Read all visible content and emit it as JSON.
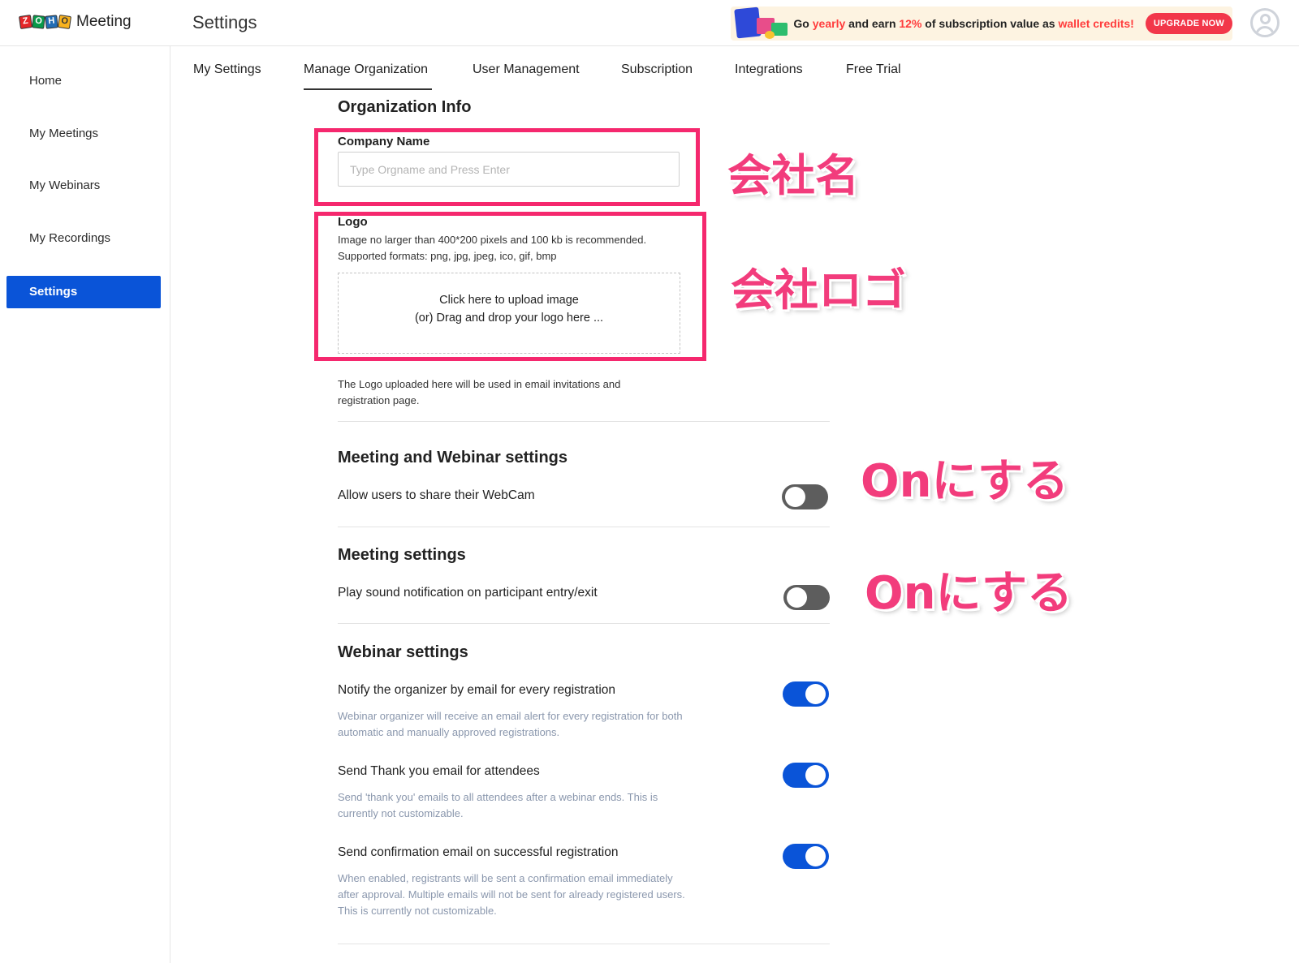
{
  "header": {
    "brand_name": "Meeting",
    "logo_letters": [
      "Z",
      "O",
      "H",
      "O"
    ],
    "page_title": "Settings",
    "promo": {
      "part1": "Go ",
      "part2": "yearly",
      "part3": " and earn ",
      "part4": "12%",
      "part5": " of subscription value as ",
      "part6": "wallet credits!",
      "button": "UPGRADE NOW"
    }
  },
  "sidebar": {
    "items": [
      {
        "label": "Home"
      },
      {
        "label": "My Meetings"
      },
      {
        "label": "My Webinars"
      },
      {
        "label": "My Recordings"
      },
      {
        "label": "Settings",
        "active": true
      }
    ]
  },
  "tabs": [
    {
      "label": "My Settings"
    },
    {
      "label": "Manage Organization",
      "active": true
    },
    {
      "label": "User Management"
    },
    {
      "label": "Subscription"
    },
    {
      "label": "Integrations"
    },
    {
      "label": "Free Trial"
    }
  ],
  "org_info": {
    "title": "Organization Info",
    "company_label": "Company Name",
    "company_placeholder": "Type Orgname and Press Enter",
    "company_value": "",
    "logo_label": "Logo",
    "logo_hint1": "Image no larger than 400*200 pixels and 100 kb is recommended.",
    "logo_hint2": "Supported formats: png, jpg, jpeg, ico, gif, bmp",
    "upload_line1": "Click here to upload image",
    "upload_line2": "(or) Drag and drop your logo here ...",
    "logo_note1": "The Logo uploaded here will be used in email invitations and",
    "logo_note2": "registration page."
  },
  "meeting_webinar": {
    "title": "Meeting and Webinar settings",
    "webcam_label": "Allow users to share their WebCam",
    "webcam_on": false
  },
  "meeting": {
    "title": "Meeting settings",
    "sound_label": "Play sound notification on participant entry/exit",
    "sound_on": false
  },
  "webinar": {
    "title": "Webinar settings",
    "notify_label": "Notify the organizer by email for every registration",
    "notify_desc1": "Webinar organizer will receive an email alert for every registration for both",
    "notify_desc2": "automatic and manually approved registrations.",
    "notify_on": true,
    "thanks_label": "Send Thank you email for attendees",
    "thanks_desc1": "Send 'thank you' emails to all attendees after a webinar ends. This is",
    "thanks_desc2": "currently not customizable.",
    "thanks_on": true,
    "confirm_label": "Send confirmation email on successful registration",
    "confirm_desc1": "When enabled, registrants will be sent a confirmation email immediately",
    "confirm_desc2": "after approval. Multiple emails will not be sent for already registered users.",
    "confirm_desc3": "This is currently not customizable.",
    "confirm_on": true
  },
  "annotations": {
    "company_name": "会社名",
    "company_logo": "会社ロゴ",
    "turn_on_1": "Onにする",
    "turn_on_2": "Onにする",
    "color": "#f5286e"
  },
  "colors": {
    "accent": "#0a54d8",
    "promo_highlight": "#ff3c3c",
    "upgrade_button": "#f2374a",
    "toggle_off": "#5d5d5d"
  }
}
